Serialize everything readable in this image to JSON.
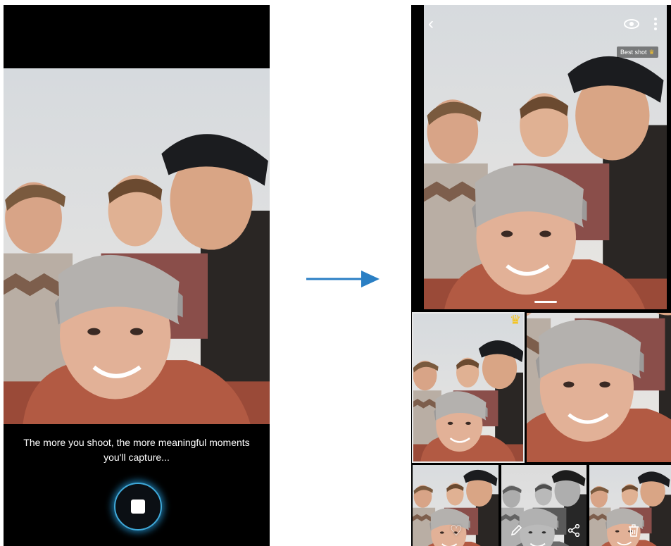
{
  "capture_screen": {
    "caption_line1": "The more you shoot, the more meaningful moments",
    "caption_line2": "you'll capture..."
  },
  "result_screen": {
    "best_shot_label": "Best shot",
    "icons": {
      "back": "back-icon",
      "view": "eye-icon",
      "more": "more-options-icon",
      "crown": "crown-icon",
      "favorite": "heart-icon",
      "edit": "pencil-icon",
      "share": "share-icon",
      "delete": "trash-icon"
    }
  },
  "colors": {
    "shutter_ring": "#3fa8d8",
    "arrow": "#2a7fc4",
    "crown": "#f5c318"
  }
}
